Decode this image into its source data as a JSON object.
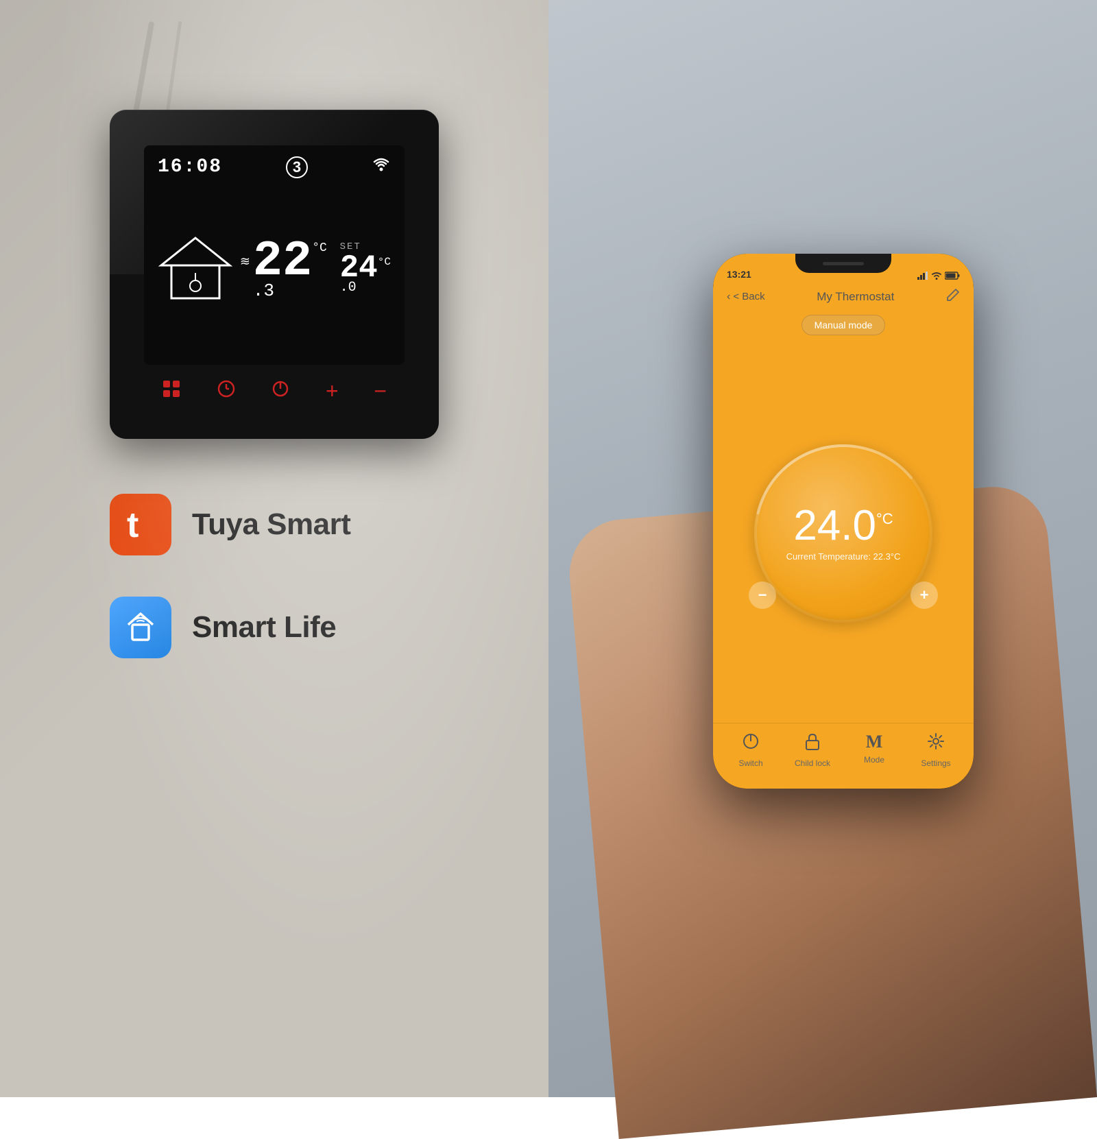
{
  "left_panel": {
    "thermostat": {
      "time": "16:08",
      "period": "3",
      "current_temp": "22",
      "current_temp_decimal": ".3",
      "current_temp_unit": "°C",
      "set_label": "SET",
      "set_temp": "24",
      "set_temp_decimal": ".0",
      "set_temp_unit": "°C"
    },
    "brands": [
      {
        "name": "Tuya Smart",
        "icon_type": "tuya",
        "icon_label": "tuya-logo"
      },
      {
        "name": "Smart Life",
        "icon_type": "smartlife",
        "icon_label": "smartlife-logo"
      }
    ]
  },
  "right_panel": {
    "phone": {
      "status_bar": {
        "time": "13:21",
        "signal_icon": "▲▲▲",
        "wifi_icon": "WiFi",
        "battery_icon": "▮▮▮"
      },
      "header": {
        "back_label": "< Back",
        "title": "My Thermostat",
        "edit_icon": "✎"
      },
      "mode_badge": "Manual mode",
      "dial": {
        "set_temp": "24.0",
        "set_temp_unit": "°C",
        "current_label": "Current Temperature: 22.3°C",
        "minus_label": "−",
        "plus_label": "+"
      },
      "nav_items": [
        {
          "icon": "⏻",
          "label": "Switch",
          "icon_name": "power-icon"
        },
        {
          "icon": "🔒",
          "label": "Child lock",
          "icon_name": "lock-icon"
        },
        {
          "icon": "M",
          "label": "Mode",
          "icon_name": "mode-icon"
        },
        {
          "icon": "⚙",
          "label": "Settings",
          "icon_name": "settings-icon"
        }
      ]
    }
  }
}
